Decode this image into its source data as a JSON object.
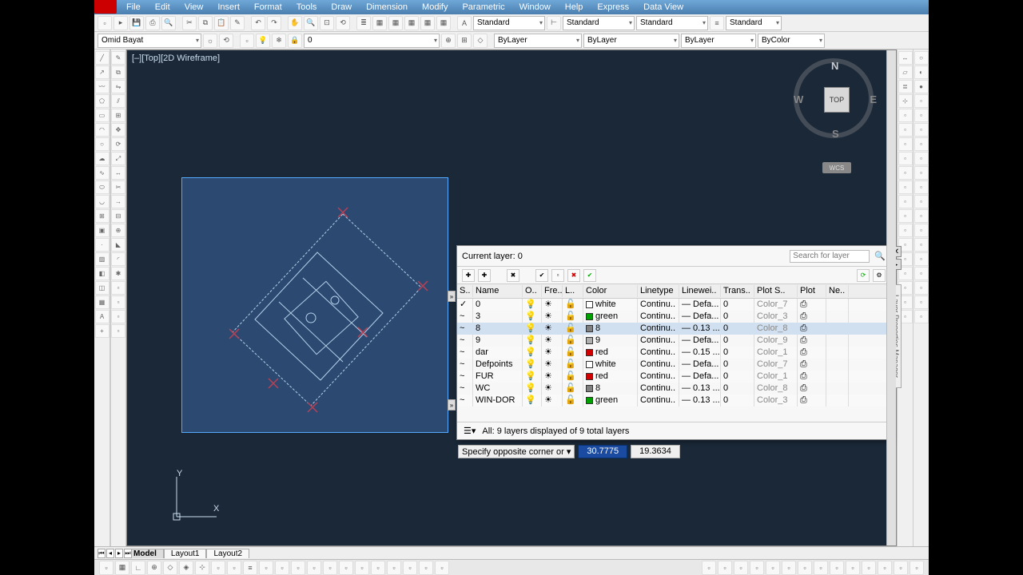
{
  "menu": [
    "File",
    "Edit",
    "View",
    "Insert",
    "Format",
    "Tools",
    "Draw",
    "Dimension",
    "Modify",
    "Parametric",
    "Window",
    "Help",
    "Express",
    "Data View"
  ],
  "toolbar2": {
    "layer_dd": "Omid Bayat",
    "std1": "Standard",
    "std2": "Standard",
    "std3": "Standard",
    "std4": "Standard",
    "bylayer1": "ByLayer",
    "bylayer2": "ByLayer",
    "bylayer3": "ByLayer",
    "bycolor": "ByColor",
    "zero": "0"
  },
  "viewlabel": "[–][Top][2D Wireframe]",
  "viewcube": {
    "top": "TOP",
    "n": "N",
    "s": "S",
    "e": "E",
    "w": "W",
    "wcs": "WCS"
  },
  "ucs": {
    "x": "X",
    "y": "Y"
  },
  "panel": {
    "title": "Current layer: 0",
    "search_ph": "Search for layer",
    "headers": [
      "S..",
      "Name",
      "O..",
      "Fre..",
      "L..",
      "Color",
      "Linetype",
      "Linewei..",
      "Trans..",
      "Plot S..",
      "Plot",
      "Ne.."
    ],
    "rows": [
      {
        "s": "✓",
        "name": "0",
        "color": "white",
        "sw": "#ffffff",
        "lt": "Continu..",
        "lw": "Defa...",
        "tr": "0",
        "ps": "Color_7"
      },
      {
        "s": "",
        "name": "3",
        "color": "green",
        "sw": "#00a000",
        "lt": "Continu..",
        "lw": "Defa...",
        "tr": "0",
        "ps": "Color_3"
      },
      {
        "s": "",
        "name": "8",
        "color": "8",
        "sw": "#808080",
        "lt": "Continu..",
        "lw": "0.13 ...",
        "tr": "0",
        "ps": "Color_8",
        "sel": true
      },
      {
        "s": "",
        "name": "9",
        "color": "9",
        "sw": "#b0b0b0",
        "lt": "Continu..",
        "lw": "Defa...",
        "tr": "0",
        "ps": "Color_9"
      },
      {
        "s": "",
        "name": "dar",
        "color": "red",
        "sw": "#d00000",
        "lt": "Continu..",
        "lw": "0.15 ...",
        "tr": "0",
        "ps": "Color_1"
      },
      {
        "s": "",
        "name": "Defpoints",
        "color": "white",
        "sw": "#ffffff",
        "lt": "Continu..",
        "lw": "Defa...",
        "tr": "0",
        "ps": "Color_7"
      },
      {
        "s": "",
        "name": "FUR",
        "color": "red",
        "sw": "#d00000",
        "lt": "Continu..",
        "lw": "Defa...",
        "tr": "0",
        "ps": "Color_1"
      },
      {
        "s": "",
        "name": "WC",
        "color": "8",
        "sw": "#808080",
        "lt": "Continu..",
        "lw": "0.13 ...",
        "tr": "0",
        "ps": "Color_8"
      },
      {
        "s": "",
        "name": "WIN-DOR",
        "color": "green",
        "sw": "#00a000",
        "lt": "Continu..",
        "lw": "0.13 ...",
        "tr": "0",
        "ps": "Color_3"
      }
    ],
    "footer": "All: 9 layers displayed of 9 total layers",
    "sidebar": "Layer Properties Manager"
  },
  "cmd": {
    "prompt": "Specify opposite corner or",
    "v1": "30.7775",
    "v2": "19.3634"
  },
  "tabs": [
    "Model",
    "Layout1",
    "Layout2"
  ]
}
